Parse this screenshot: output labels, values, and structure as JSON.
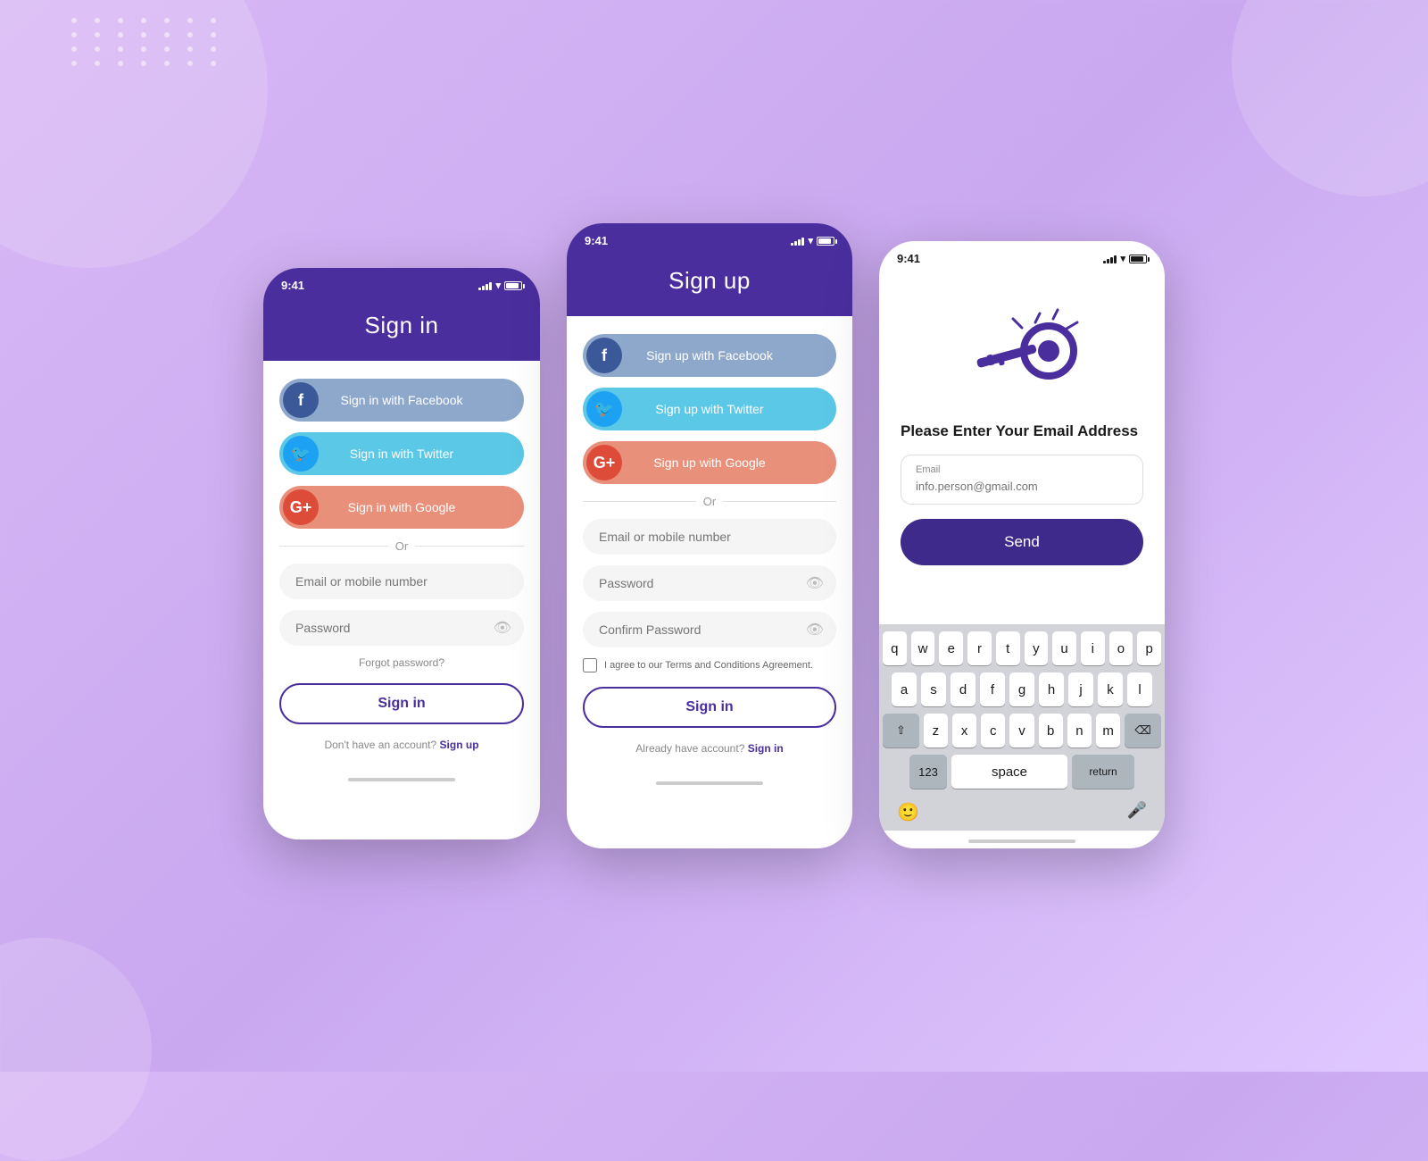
{
  "background": {
    "color": "#d8b4f8"
  },
  "phone1": {
    "status_time": "9:41",
    "title": "Sign in",
    "facebook_btn": "Sign in with Facebook",
    "twitter_btn": "Sign in with Twitter",
    "google_btn": "Sign in with Google",
    "divider_text": "Or",
    "email_placeholder": "Email or mobile number",
    "password_placeholder": "Password",
    "forgot_password": "Forgot password?",
    "signin_btn": "Sign in",
    "footer_text": "Don't have an account?",
    "footer_link": "Sign up"
  },
  "phone2": {
    "status_time": "9:41",
    "title": "Sign up",
    "facebook_btn": "Sign up with Facebook",
    "twitter_btn": "Sign up with Twitter",
    "google_btn": "Sign up with Google",
    "divider_text": "Or",
    "email_placeholder": "Email or mobile number",
    "password_placeholder": "Password",
    "confirm_placeholder": "Confirm Password",
    "terms_text": "I agree to our Terms and Conditions Agreement.",
    "signin_btn": "Sign in",
    "footer_text": "Already have account?",
    "footer_link": "Sign in"
  },
  "phone3": {
    "status_time": "9:41",
    "title": "Please Enter Your Email Address",
    "email_label": "Email",
    "email_placeholder": "info.person@gmail.com",
    "send_btn": "Send",
    "keyboard": {
      "row1": [
        "q",
        "w",
        "e",
        "r",
        "t",
        "y",
        "u",
        "i",
        "o",
        "p"
      ],
      "row2": [
        "a",
        "s",
        "d",
        "f",
        "g",
        "h",
        "j",
        "k",
        "l"
      ],
      "row3": [
        "z",
        "x",
        "c",
        "v",
        "b",
        "n",
        "m"
      ],
      "row4_left": "123",
      "row4_space": "space",
      "row4_return": "return"
    }
  }
}
